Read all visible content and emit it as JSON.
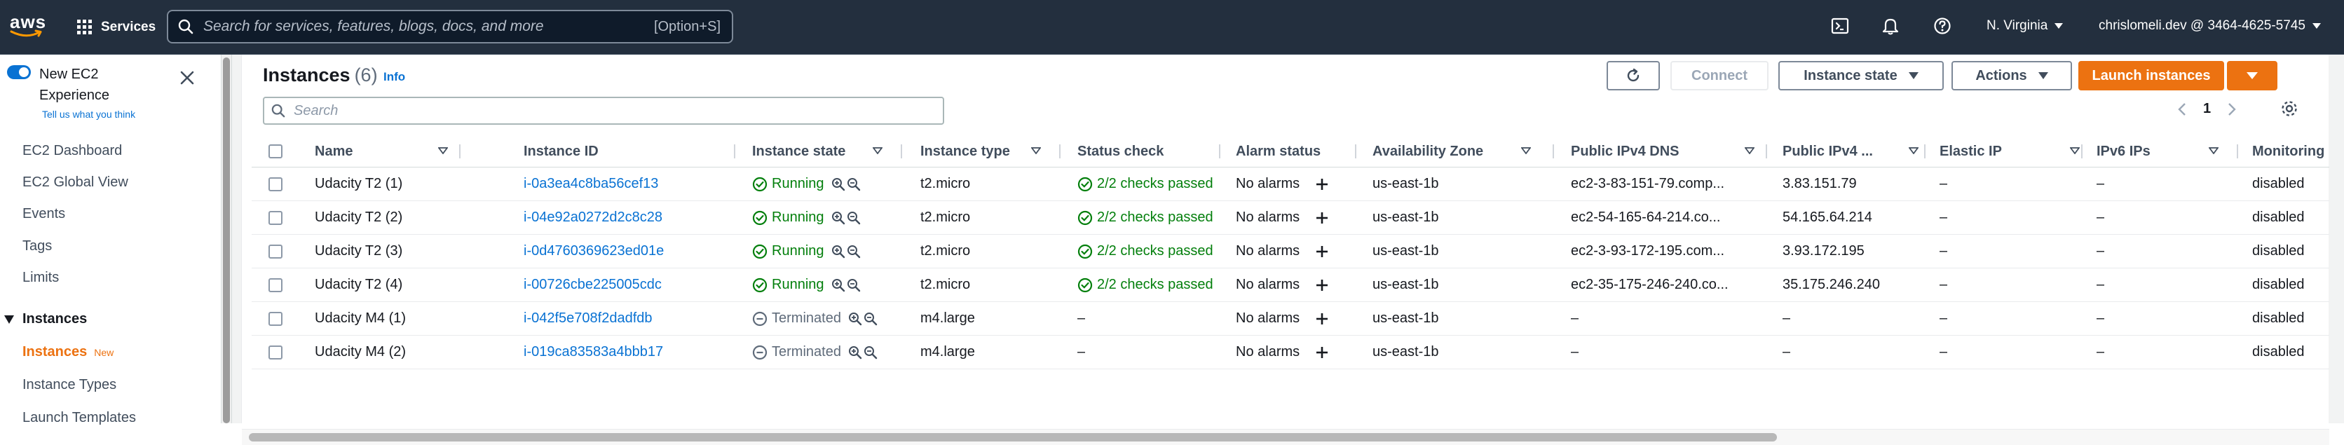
{
  "topnav": {
    "logo_text": "aws",
    "services_label": "Services",
    "search_placeholder": "Search for services, features, blogs, docs, and more",
    "search_shortcut": "[Option+S]",
    "region": "N. Virginia",
    "account": "chrislomeli.dev @ 3464-4625-5745",
    "icons": [
      "cloudshell-icon",
      "bell-icon",
      "help-icon"
    ]
  },
  "sidebar": {
    "new_experience_label": "New EC2 Experience",
    "tell_us_link": "Tell us what you think",
    "items": [
      {
        "label": "EC2 Dashboard"
      },
      {
        "label": "EC2 Global View"
      },
      {
        "label": "Events"
      },
      {
        "label": "Tags"
      },
      {
        "label": "Limits"
      }
    ],
    "section": {
      "label": "Instances"
    },
    "section_items": [
      {
        "label": "Instances",
        "badge": "New",
        "active": true
      },
      {
        "label": "Instance Types"
      },
      {
        "label": "Launch Templates"
      }
    ]
  },
  "header": {
    "title": "Instances",
    "count": "(6)",
    "info_label": "Info",
    "buttons": {
      "connect": "Connect",
      "instance_state": "Instance state",
      "actions": "Actions",
      "launch": "Launch instances"
    }
  },
  "filter": {
    "placeholder": "Search"
  },
  "pagination": {
    "page": "1"
  },
  "table": {
    "columns": [
      "Name",
      "Instance ID",
      "Instance state",
      "Instance type",
      "Status check",
      "Alarm status",
      "Availability Zone",
      "Public IPv4 DNS",
      "Public IPv4 ...",
      "Elastic IP",
      "IPv6 IPs",
      "Monitoring"
    ],
    "rows": [
      {
        "name": "Udacity T2 (1)",
        "id": "i-0a3ea4c8ba56cef13",
        "state": "Running",
        "type": "t2.micro",
        "status": "2/2 checks passed",
        "alarm": "No alarms",
        "az": "us-east-1b",
        "dns": "ec2-3-83-151-79.comp...",
        "ip": "3.83.151.79",
        "eip": "–",
        "ipv6": "–",
        "monitoring": "disabled"
      },
      {
        "name": "Udacity T2 (2)",
        "id": "i-04e92a0272d2c8c28",
        "state": "Running",
        "type": "t2.micro",
        "status": "2/2 checks passed",
        "alarm": "No alarms",
        "az": "us-east-1b",
        "dns": "ec2-54-165-64-214.co...",
        "ip": "54.165.64.214",
        "eip": "–",
        "ipv6": "–",
        "monitoring": "disabled"
      },
      {
        "name": "Udacity T2 (3)",
        "id": "i-0d4760369623ed01e",
        "state": "Running",
        "type": "t2.micro",
        "status": "2/2 checks passed",
        "alarm": "No alarms",
        "az": "us-east-1b",
        "dns": "ec2-3-93-172-195.com...",
        "ip": "3.93.172.195",
        "eip": "–",
        "ipv6": "–",
        "monitoring": "disabled"
      },
      {
        "name": "Udacity T2 (4)",
        "id": "i-00726cbe225005cdc",
        "state": "Running",
        "type": "t2.micro",
        "status": "2/2 checks passed",
        "alarm": "No alarms",
        "az": "us-east-1b",
        "dns": "ec2-35-175-246-240.co...",
        "ip": "35.175.246.240",
        "eip": "–",
        "ipv6": "–",
        "monitoring": "disabled"
      },
      {
        "name": "Udacity M4 (1)",
        "id": "i-042f5e708f2dadfdb",
        "state": "Terminated",
        "type": "m4.large",
        "status": "–",
        "alarm": "No alarms",
        "az": "us-east-1b",
        "dns": "–",
        "ip": "–",
        "eip": "–",
        "ipv6": "–",
        "monitoring": "disabled"
      },
      {
        "name": "Udacity M4 (2)",
        "id": "i-019ca83583a4bbb17",
        "state": "Terminated",
        "type": "m4.large",
        "status": "–",
        "alarm": "No alarms",
        "az": "us-east-1b",
        "dns": "–",
        "ip": "–",
        "eip": "–",
        "ipv6": "–",
        "monitoring": "disabled"
      }
    ]
  },
  "colors": {
    "nav_bg": "#232f3e",
    "link": "#0972d3",
    "primary": "#ec7211",
    "success": "#037f0c",
    "terminated": "#5f6b7a"
  }
}
